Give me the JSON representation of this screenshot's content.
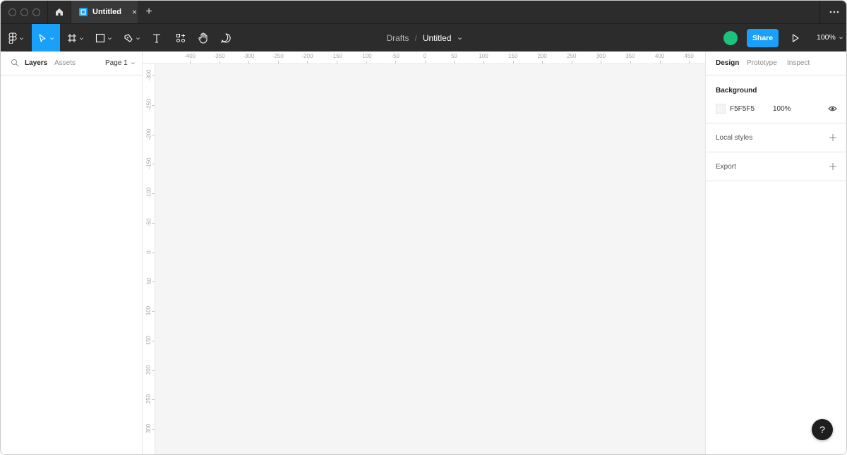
{
  "tab": {
    "title": "Untitled",
    "close_glyph": "×",
    "add_glyph": "+"
  },
  "toolbar": {
    "tools": [
      "figma-menu",
      "move-tool",
      "frame-tool",
      "shape-tool",
      "pen-tool",
      "text-tool",
      "components-tool",
      "hand-tool",
      "comment-tool"
    ],
    "active_tool": "move-tool",
    "breadcrumb_project": "Drafts",
    "breadcrumb_sep": "/",
    "breadcrumb_file": "Untitled",
    "share_label": "Share",
    "zoom": "100%"
  },
  "left_panel": {
    "tabs": [
      "Layers",
      "Assets"
    ],
    "selected_tab": "Layers",
    "page": "Page 1"
  },
  "rulers": {
    "x_labels": [
      "-400",
      "-350",
      "-300",
      "-250",
      "-200",
      "-150",
      "-100",
      "-50",
      "0",
      "50",
      "100",
      "150",
      "200",
      "250",
      "300",
      "350",
      "400",
      "450"
    ],
    "y_labels": [
      "-300",
      "-250",
      "-200",
      "-150",
      "-100",
      "-50",
      "0",
      "50",
      "100",
      "150",
      "200",
      "250",
      "300"
    ]
  },
  "right_panel": {
    "tabs": [
      "Design",
      "Prototype",
      "Inspect"
    ],
    "selected_tab": "Design",
    "background": {
      "title": "Background",
      "hex": "F5F5F5",
      "opacity": "100%",
      "color": "#f5f5f5"
    },
    "local_styles": {
      "title": "Local styles"
    },
    "export": {
      "title": "Export"
    }
  },
  "help": {
    "label": "?"
  },
  "colors": {
    "accent": "#18a0fb",
    "chrome": "#2c2c2c",
    "avatar": "#1bc47d",
    "canvas": "#f5f5f5"
  }
}
